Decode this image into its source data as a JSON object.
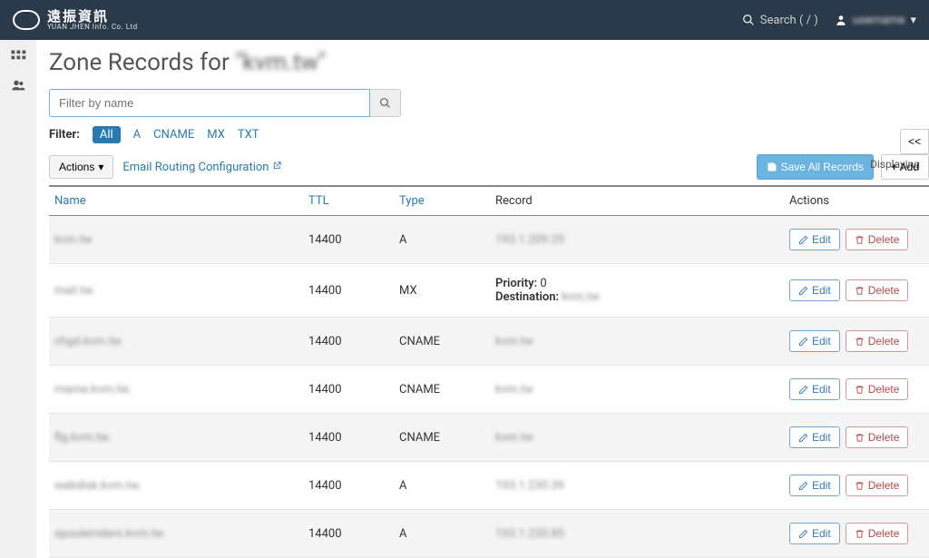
{
  "topbar": {
    "brand_main": "遠振資訊",
    "brand_sub": "YUAN JHEN Info. Co. Ltd",
    "search_label": "Search ( / )",
    "user_name": "username"
  },
  "page": {
    "title_prefix": "Zone Records for ",
    "zone_name": "\"kvm.tw\"",
    "filter_placeholder": "Filter by name",
    "filter_label": "Filter:",
    "tabs": {
      "all": "All",
      "a": "A",
      "cname": "CNAME",
      "mx": "MX",
      "txt": "TXT"
    },
    "actions_btn": "Actions",
    "email_routing": "Email Routing Configuration",
    "save_all": "Save All Records",
    "add_btn": "Add",
    "displaying": "Displaying",
    "prev": "<<"
  },
  "table": {
    "headers": {
      "name": "Name",
      "ttl": "TTL",
      "type": "Type",
      "record": "Record",
      "actions": "Actions"
    },
    "edit": "Edit",
    "delete": "Delete",
    "priority_label": "Priority:",
    "dest_label": "Destination:",
    "rows": [
      {
        "name": "kvm.tw",
        "ttl": "14400",
        "type": "A",
        "record": "193.1.209.25"
      },
      {
        "name": "mail.tw.",
        "ttl": "14400",
        "type": "MX",
        "priority": "0",
        "dest": "kvm.tw"
      },
      {
        "name": "chgd.kvm.tw.",
        "ttl": "14400",
        "type": "CNAME",
        "record": "kvm.tw"
      },
      {
        "name": "mama.kvm.tw.",
        "ttl": "14400",
        "type": "CNAME",
        "record": "kvm.tw"
      },
      {
        "name": "flg.kvm.tw.",
        "ttl": "14400",
        "type": "CNAME",
        "record": "kvm.tw"
      },
      {
        "name": "webdisk.kvm.tw.",
        "ttl": "14400",
        "type": "A",
        "record": "193.1.230.39"
      },
      {
        "name": "spoulemders.kvm.tw.",
        "ttl": "14400",
        "type": "A",
        "record": "193.1.230.85"
      }
    ]
  }
}
